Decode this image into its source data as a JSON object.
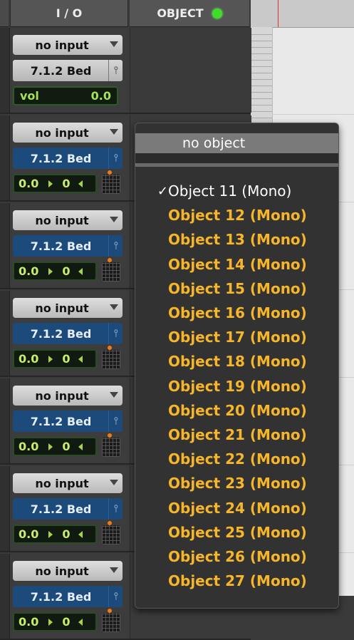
{
  "header": {
    "io_label": "I / O",
    "object_label": "OBJECT"
  },
  "strips": [
    {
      "input": "no input",
      "bed": "7.1.2 Bed",
      "bed_style": "grey",
      "control": "vol",
      "vol_label": "vol",
      "vol_value": "0.0"
    },
    {
      "input": "no input",
      "bed": "7.1.2 Bed",
      "bed_style": "blue",
      "control": "pan",
      "pan_left": "0.0",
      "pan_right": "0"
    },
    {
      "input": "no input",
      "bed": "7.1.2 Bed",
      "bed_style": "blue",
      "control": "pan",
      "pan_left": "0.0",
      "pan_right": "0"
    },
    {
      "input": "no input",
      "bed": "7.1.2 Bed",
      "bed_style": "blue",
      "control": "pan",
      "pan_left": "0.0",
      "pan_right": "0"
    },
    {
      "input": "no input",
      "bed": "7.1.2 Bed",
      "bed_style": "blue",
      "control": "pan",
      "pan_left": "0.0",
      "pan_right": "0"
    },
    {
      "input": "no input",
      "bed": "7.1.2 Bed",
      "bed_style": "blue",
      "control": "pan",
      "pan_left": "0.0",
      "pan_right": "0"
    },
    {
      "input": "no input",
      "bed": "7.1.2 Bed",
      "bed_style": "blue",
      "control": "pan",
      "pan_left": "0.0",
      "pan_right": "0"
    }
  ],
  "menu": {
    "no_object": "no object",
    "checkmark": "✓",
    "items": [
      "Object 11 (Mono)",
      "Object 12 (Mono)",
      "Object 13 (Mono)",
      "Object 14 (Mono)",
      "Object 15 (Mono)",
      "Object 16 (Mono)",
      "Object 17 (Mono)",
      "Object 18 (Mono)",
      "Object 19 (Mono)",
      "Object 20 (Mono)",
      "Object 21 (Mono)",
      "Object 22 (Mono)",
      "Object 23 (Mono)",
      "Object 24 (Mono)",
      "Object 25 (Mono)",
      "Object 26 (Mono)",
      "Object 27 (Mono)"
    ],
    "checked_index": 0
  },
  "colors": {
    "object_item": "#f7b62a",
    "object_status": "#3fdc2a",
    "bed_blue": "#1b4a7b",
    "pan_text": "#c7ee6a"
  },
  "icons": {
    "header_status": "green-status-dot-icon",
    "dropdown": "triangle-down-icon",
    "fork": "fork-icon",
    "grid": "grid-icon"
  }
}
